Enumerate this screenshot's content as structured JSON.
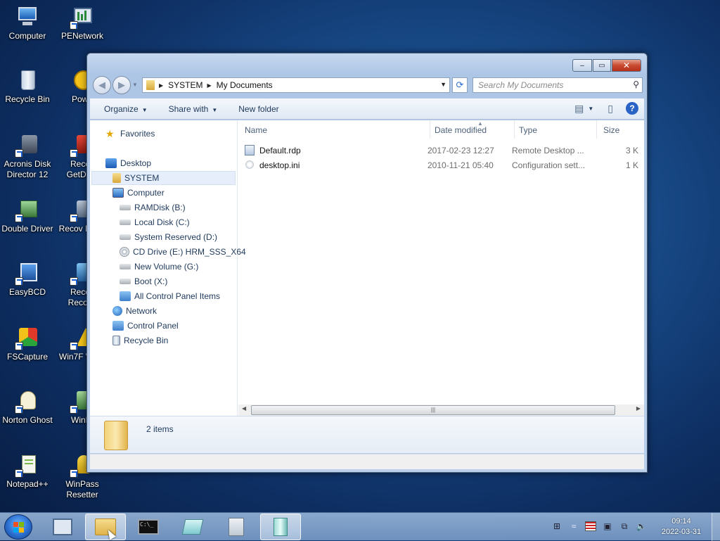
{
  "desktop": {
    "icons": [
      {
        "label": "Computer",
        "icon": "computer-icon"
      },
      {
        "label": "PENetwork",
        "icon": "network-adapter-icon"
      },
      {
        "label": "Recycle Bin",
        "icon": "recycle-bin-icon"
      },
      {
        "label": "Powe",
        "icon": "power-icon"
      },
      {
        "label": "Acronis Disk Director 12",
        "icon": "acronis-icon"
      },
      {
        "label": "Recov GetData",
        "icon": "recovery-app-icon"
      },
      {
        "label": "Double Driver",
        "icon": "double-driver-icon"
      },
      {
        "label": "Recov MiniT",
        "icon": "minitool-icon"
      },
      {
        "label": "EasyBCD",
        "icon": "easybcd-icon"
      },
      {
        "label": "Recov Recove",
        "icon": "recovery-icon"
      },
      {
        "label": "FSCapture",
        "icon": "fscapture-icon"
      },
      {
        "label": "Win7F Warn",
        "icon": "warning-app-icon"
      },
      {
        "label": "Norton Ghost",
        "icon": "ghost-icon"
      },
      {
        "label": "WinDi",
        "icon": "windisk-icon"
      },
      {
        "label": "Notepad++",
        "icon": "notepadpp-icon"
      },
      {
        "label": "WinPass Resetter",
        "icon": "winpass-icon"
      }
    ]
  },
  "window": {
    "caption": {
      "minimize": "–",
      "maximize": "▭",
      "close": "✕"
    },
    "address": {
      "segments": [
        "SYSTEM",
        "My Documents"
      ]
    },
    "search": {
      "placeholder": "Search My Documents"
    },
    "toolbar": {
      "organize": "Organize",
      "share_with": "Share with",
      "new_folder": "New folder"
    },
    "nav_tree": [
      {
        "label": "Favorites",
        "icon": "star-icon"
      },
      {
        "label": "Desktop",
        "icon": "desktop-icon"
      },
      {
        "label": "SYSTEM",
        "icon": "user-folder-icon",
        "selected": true
      },
      {
        "label": "Computer",
        "icon": "computer-icon"
      },
      {
        "label": "RAMDisk (B:)",
        "icon": "drive-icon"
      },
      {
        "label": "Local Disk (C:)",
        "icon": "drive-icon"
      },
      {
        "label": "System Reserved (D:)",
        "icon": "drive-icon"
      },
      {
        "label": "CD Drive (E:) HRM_SSS_X64",
        "icon": "cd-drive-icon"
      },
      {
        "label": "New Volume (G:)",
        "icon": "drive-icon"
      },
      {
        "label": "Boot (X:)",
        "icon": "drive-icon"
      },
      {
        "label": "All Control Panel Items",
        "icon": "control-panel-icon"
      },
      {
        "label": "Network",
        "icon": "network-icon"
      },
      {
        "label": "Control Panel",
        "icon": "control-panel-icon"
      },
      {
        "label": "Recycle Bin",
        "icon": "recycle-bin-icon"
      }
    ],
    "columns": {
      "name": "Name",
      "date_modified": "Date modified",
      "type": "Type",
      "size": "Size"
    },
    "files": [
      {
        "name": "Default.rdp",
        "date": "2017-02-23 12:27",
        "type": "Remote Desktop ...",
        "size": "3 K",
        "icon": "rdp-file-icon"
      },
      {
        "name": "desktop.ini",
        "date": "2010-11-21 05:40",
        "type": "Configuration sett...",
        "size": "1 K",
        "icon": "ini-file-icon"
      }
    ],
    "details": {
      "count": "2 items"
    }
  },
  "taskbar": {
    "items": [
      "network-app-icon",
      "explorer-icon",
      "cmd-icon",
      "notes-icon",
      "calculator-icon",
      "recycle-app-icon"
    ],
    "clock": {
      "time": "09:14",
      "date": "2022-03-31"
    }
  }
}
